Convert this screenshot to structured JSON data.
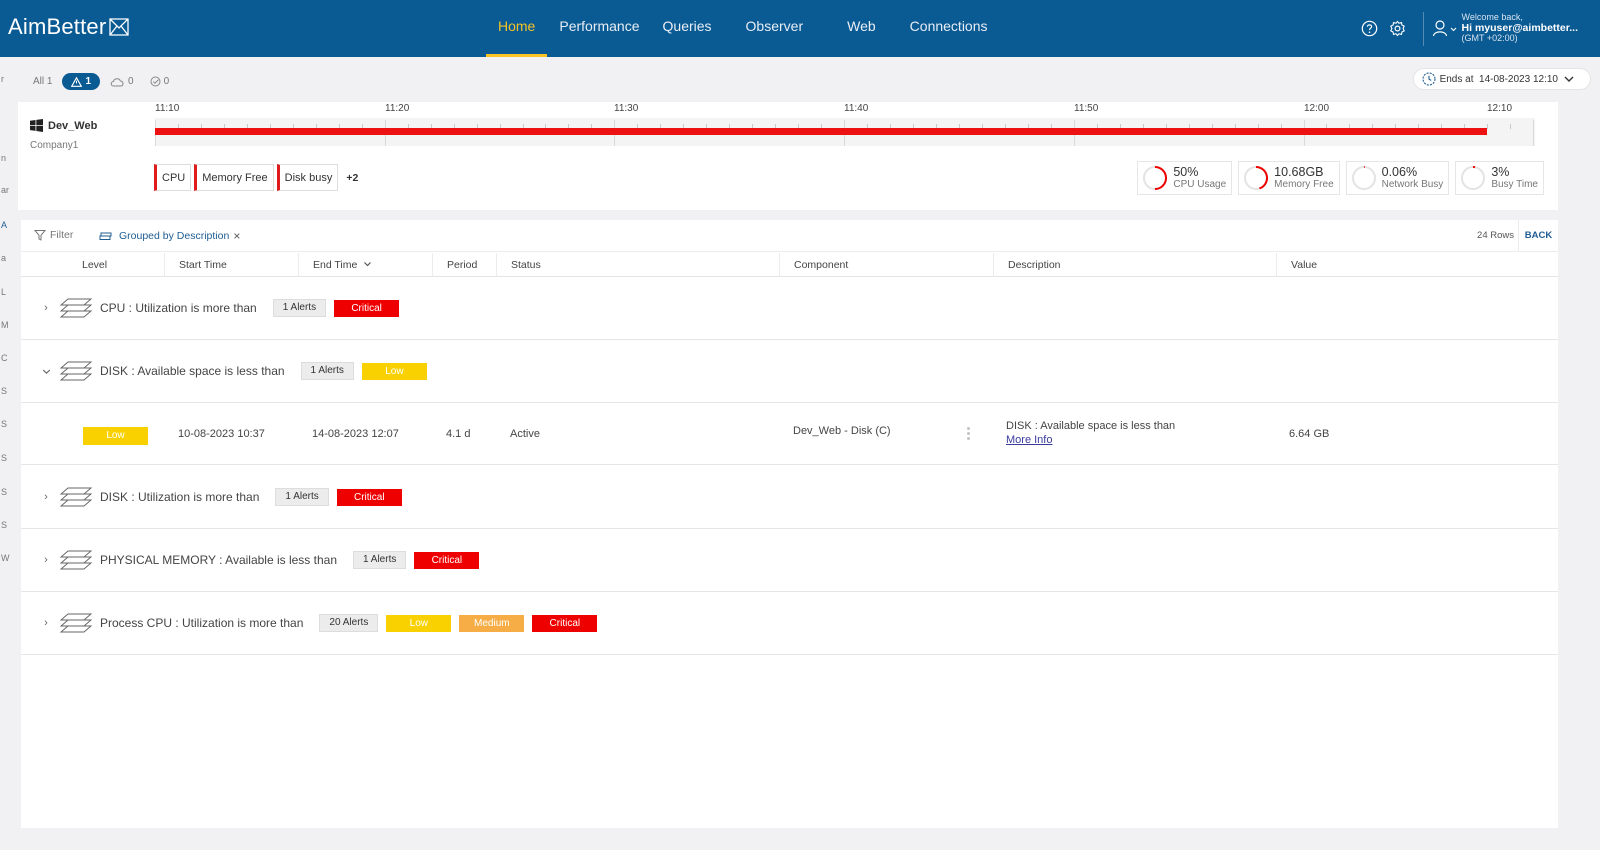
{
  "app": {
    "logo": "AimBetter",
    "nav": [
      "Home",
      "Performance",
      "Queries",
      "Observer",
      "Web",
      "Connections"
    ],
    "active_nav": "Home",
    "user": {
      "welcome": "Welcome back,",
      "name": "Hi myuser@aimbetter...",
      "tz": "(GMT +02:00)"
    },
    "accent": "#0a5a94"
  },
  "left_rail": [
    "r",
    "n",
    "ar",
    "A",
    "a",
    "L",
    "M",
    "C",
    "S",
    "S",
    "S",
    "S",
    "S",
    "W"
  ],
  "alert_filters": {
    "all": "All 1",
    "warning": "1",
    "cloud": "0",
    "resolved": "0"
  },
  "ends_at": "Ends at  14-08-2023 12:10",
  "server": {
    "name": "Dev_Web",
    "company": "Company1",
    "time_labels": [
      "11:10",
      "11:20",
      "11:30",
      "11:40",
      "11:50",
      "12:00",
      "12:10"
    ],
    "alert_fill": 0.965,
    "chips": [
      "CPU",
      "Memory Free",
      "Disk busy"
    ],
    "more": "+2",
    "metrics": [
      {
        "value": "50%",
        "label": "CPU Usage",
        "ratio": 0.5
      },
      {
        "value": "10.68GB",
        "label": "Memory Free",
        "ratio": 0.45
      },
      {
        "value": "0.06%",
        "label": "Network Busy",
        "ratio": 0.0006
      },
      {
        "value": "3%",
        "label": "Busy Time",
        "ratio": 0.03
      }
    ]
  },
  "grid": {
    "filter": "Filter",
    "grouped": "Grouped by Description",
    "rows": "24 Rows",
    "back": "BACK",
    "columns": [
      "Level",
      "Start Time",
      "End Time",
      "Period",
      "Status",
      "Component",
      "Description",
      "Value"
    ],
    "groups": [
      {
        "title": "CPU : Utilization is more than",
        "count": "1 Alerts",
        "levels": [
          "Critical"
        ],
        "expanded": false
      },
      {
        "title": "DISK : Available space is less than",
        "count": "1 Alerts",
        "levels": [
          "Low"
        ],
        "expanded": true
      },
      {
        "title": "DISK : Utilization is more than",
        "count": "1 Alerts",
        "levels": [
          "Critical"
        ],
        "expanded": false
      },
      {
        "title": "PHYSICAL MEMORY : Available is less than",
        "count": "1 Alerts",
        "levels": [
          "Critical"
        ],
        "expanded": false
      },
      {
        "title": "Process CPU : Utilization is more than",
        "count": "20 Alerts",
        "levels": [
          "Low",
          "Medium",
          "Critical"
        ],
        "expanded": false
      }
    ],
    "detail": {
      "level": "Low",
      "start": "10-08-2023 10:37",
      "end": "14-08-2023 12:07",
      "period": "4.1 d",
      "status": "Active",
      "component": "Dev_Web - Disk (C)",
      "description": "DISK : Available space is less than",
      "more_info": "More Info",
      "value": "6.64 GB"
    }
  },
  "colors": {
    "critical": "#ee0000",
    "low": "#f9d100",
    "medium": "#f7ad46",
    "nav_active": "#f7c325"
  }
}
